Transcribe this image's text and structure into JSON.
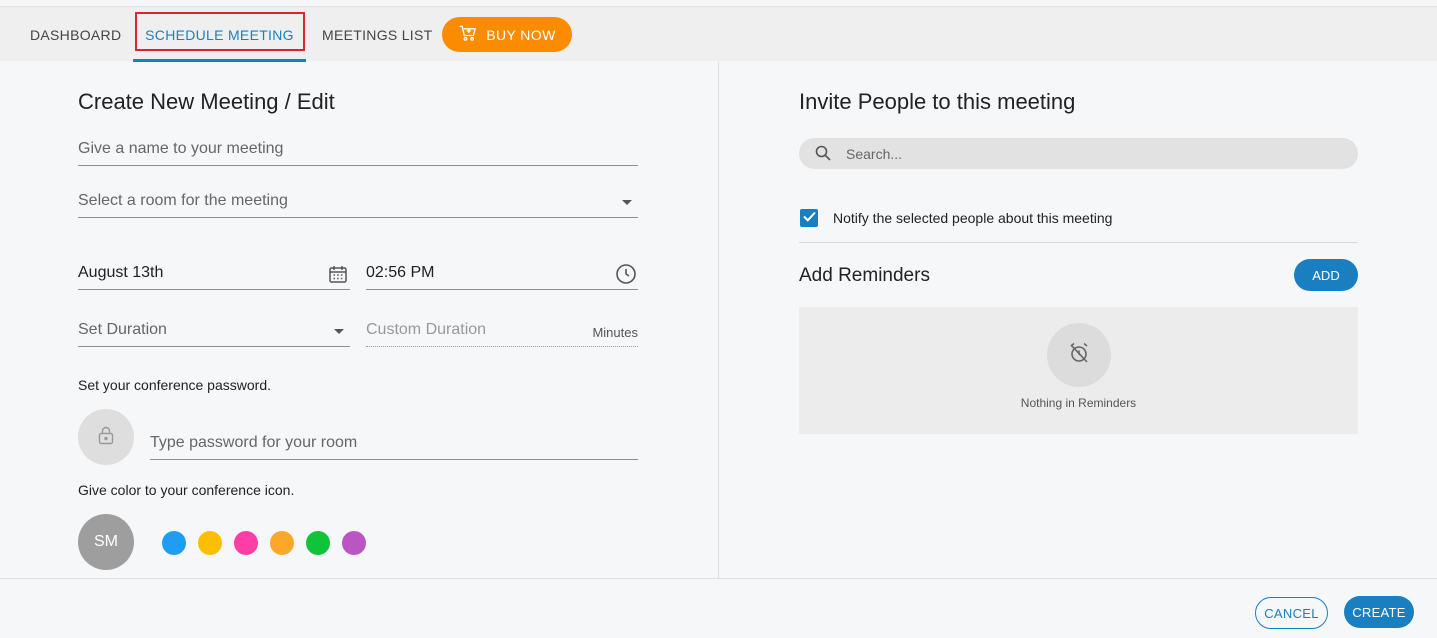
{
  "nav": {
    "tabs": [
      {
        "label": "DASHBOARD"
      },
      {
        "label": "SCHEDULE MEETING"
      },
      {
        "label": "MEETINGS LIST"
      }
    ],
    "buy_label": "BUY NOW",
    "buy_icon": "cart-icon",
    "buy_color": "#fb8c00",
    "active_color": "#1a7fc1"
  },
  "left": {
    "title": "Create New Meeting / Edit",
    "name_placeholder": "Give a name to your meeting",
    "room_placeholder": "Select a room for the meeting",
    "date_value": "August 13th",
    "time_value": "02:56 PM",
    "duration_placeholder": "Set Duration",
    "custom_duration_placeholder": "Custom Duration",
    "minutes_label": "Minutes",
    "password_label": "Set your conference password.",
    "password_placeholder": "Type password for your room",
    "color_label": "Give color to your conference icon.",
    "avatar_initials": "SM",
    "swatches": [
      "#1e9df2",
      "#fbbf00",
      "#fb3fa4",
      "#fba72a",
      "#10c43a",
      "#bb55c4"
    ]
  },
  "right": {
    "title": "Invite People to this meeting",
    "search_placeholder": "Search...",
    "notify_label": "Notify the selected people about this meeting",
    "notify_checked": true,
    "reminders_title": "Add Reminders",
    "add_label": "ADD",
    "empty_text": "Nothing in Reminders"
  },
  "footer": {
    "cancel_label": "CANCEL",
    "create_label": "CREATE"
  }
}
